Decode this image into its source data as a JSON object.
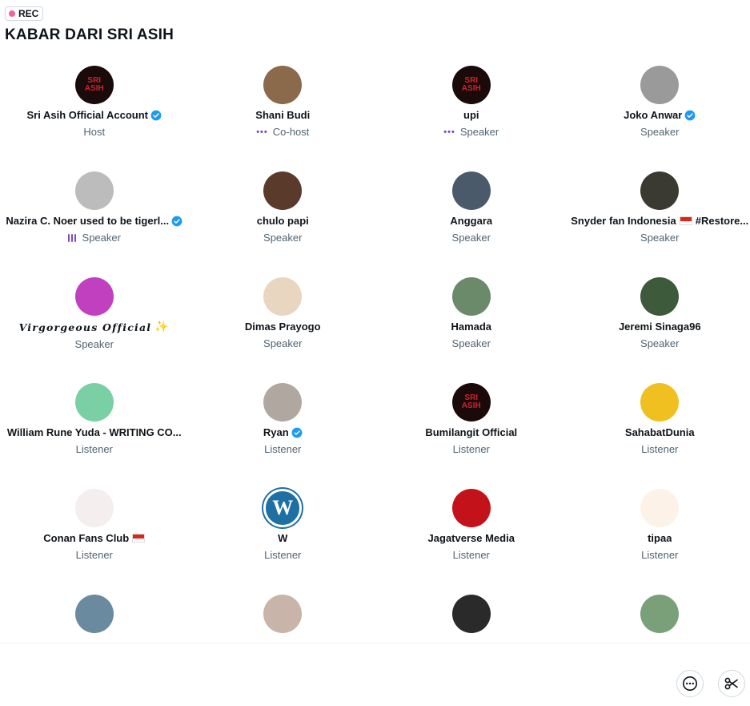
{
  "rec_label": "REC",
  "space_title": "KABAR DARI SRI ASIH",
  "participants": [
    {
      "name": "Sri Asih Official Account",
      "verified": true,
      "role": "Host",
      "indicator": "",
      "avatar_text": "SRI ASIH",
      "avatar_bg": "#1a0a0a",
      "avatar_fg": "#d1242a"
    },
    {
      "name": "Shani Budi",
      "verified": false,
      "role": "Co-host",
      "indicator": "dots",
      "avatar_text": "",
      "avatar_bg": "#8a6a4a",
      "avatar_fg": "#ffffff"
    },
    {
      "name": "upi",
      "verified": false,
      "role": "Speaker",
      "indicator": "dots",
      "avatar_text": "SRI ASIH",
      "avatar_bg": "#1a0a0a",
      "avatar_fg": "#d1242a"
    },
    {
      "name": "Joko Anwar",
      "verified": true,
      "role": "Speaker",
      "indicator": "",
      "avatar_text": "",
      "avatar_bg": "#9a9a9a",
      "avatar_fg": "#ffffff"
    },
    {
      "name": "Nazira C. Noer used to be tigerl...",
      "verified": true,
      "role": "Speaker",
      "indicator": "bars",
      "avatar_text": "",
      "avatar_bg": "#bcbcbc",
      "avatar_fg": "#ffffff"
    },
    {
      "name": "chulo papi",
      "verified": false,
      "role": "Speaker",
      "indicator": "",
      "avatar_text": "",
      "avatar_bg": "#5a3a2a",
      "avatar_fg": "#ffffff"
    },
    {
      "name": "Anggara",
      "verified": false,
      "role": "Speaker",
      "indicator": "",
      "avatar_text": "",
      "avatar_bg": "#4a5a6a",
      "avatar_fg": "#ffffff"
    },
    {
      "name": "Snyder fan Indonesia",
      "suffix": "#Restore...",
      "flag": true,
      "verified": false,
      "role": "Speaker",
      "indicator": "",
      "avatar_text": "",
      "avatar_bg": "#3a3a32",
      "avatar_fg": "#ffffff"
    },
    {
      "name": "Virgorgeous Official",
      "fancy": true,
      "sparkle": "✨",
      "verified": false,
      "role": "Speaker",
      "indicator": "",
      "avatar_text": "",
      "avatar_bg": "#c040c0",
      "avatar_fg": "#ffffff"
    },
    {
      "name": "Dimas Prayogo",
      "verified": false,
      "role": "Speaker",
      "indicator": "",
      "avatar_text": "",
      "avatar_bg": "#e9d6c0",
      "avatar_fg": "#d1242a"
    },
    {
      "name": "Hamada",
      "verified": false,
      "role": "Speaker",
      "indicator": "",
      "avatar_text": "",
      "avatar_bg": "#6a8a6a",
      "avatar_fg": "#ffffff"
    },
    {
      "name": "Jeremi Sinaga96",
      "verified": false,
      "role": "Speaker",
      "indicator": "",
      "avatar_text": "",
      "avatar_bg": "#3d5a3a",
      "avatar_fg": "#ffffff"
    },
    {
      "name": "William Rune Yuda - WRITING CO...",
      "verified": false,
      "role": "Listener",
      "indicator": "",
      "avatar_text": "",
      "avatar_bg": "#7acfa5",
      "avatar_fg": "#ffffff"
    },
    {
      "name": "Ryan",
      "verified": true,
      "role": "Listener",
      "indicator": "",
      "avatar_text": "",
      "avatar_bg": "#b0a8a0",
      "avatar_fg": "#ffffff"
    },
    {
      "name": "Bumilangit Official",
      "verified": false,
      "role": "Listener",
      "indicator": "",
      "avatar_text": "SRI ASIH",
      "avatar_bg": "#1a0a0a",
      "avatar_fg": "#d1242a"
    },
    {
      "name": "SahabatDunia",
      "verified": false,
      "role": "Listener",
      "indicator": "",
      "avatar_text": "",
      "avatar_bg": "#f0c020",
      "avatar_fg": "#ffffff"
    },
    {
      "name": "Conan Fans Club",
      "flag": true,
      "verified": false,
      "role": "Listener",
      "indicator": "",
      "avatar_text": "",
      "avatar_bg": "#f4eeee",
      "avatar_fg": "#b01020"
    },
    {
      "name": "W",
      "verified": false,
      "role": "Listener",
      "indicator": "",
      "avatar_text": "W",
      "avatar_bg": "#1e6fa3",
      "avatar_fg": "#ffffff"
    },
    {
      "name": "Jagatverse Media",
      "verified": false,
      "role": "Listener",
      "indicator": "",
      "avatar_text": "",
      "avatar_bg": "#c4121b",
      "avatar_fg": "#ffffff"
    },
    {
      "name": "tipaa",
      "verified": false,
      "role": "Listener",
      "indicator": "",
      "avatar_text": "",
      "avatar_bg": "#fdf2e8",
      "avatar_fg": "#7a4a2a"
    },
    {
      "name": "",
      "verified": false,
      "role": "",
      "indicator": "",
      "avatar_text": "",
      "avatar_bg": "#6a8aa0",
      "avatar_fg": "#ffffff"
    },
    {
      "name": "",
      "verified": false,
      "role": "",
      "indicator": "",
      "avatar_text": "",
      "avatar_bg": "#c8b4a8",
      "avatar_fg": "#ffffff"
    },
    {
      "name": "",
      "verified": false,
      "role": "",
      "indicator": "",
      "avatar_text": "",
      "avatar_bg": "#2a2a2a",
      "avatar_fg": "#ffffff"
    },
    {
      "name": "",
      "verified": false,
      "role": "",
      "indicator": "",
      "avatar_text": "",
      "avatar_bg": "#7aa07a",
      "avatar_fg": "#ffffff"
    }
  ],
  "controls": {
    "more_icon": "more-circle-icon",
    "clip_icon": "scissors-icon"
  },
  "colors": {
    "verified": "#1d9bf0",
    "speaking_indicator": "#794bc4",
    "rec_dot": "#f4629b",
    "secondary_text": "#536471"
  }
}
